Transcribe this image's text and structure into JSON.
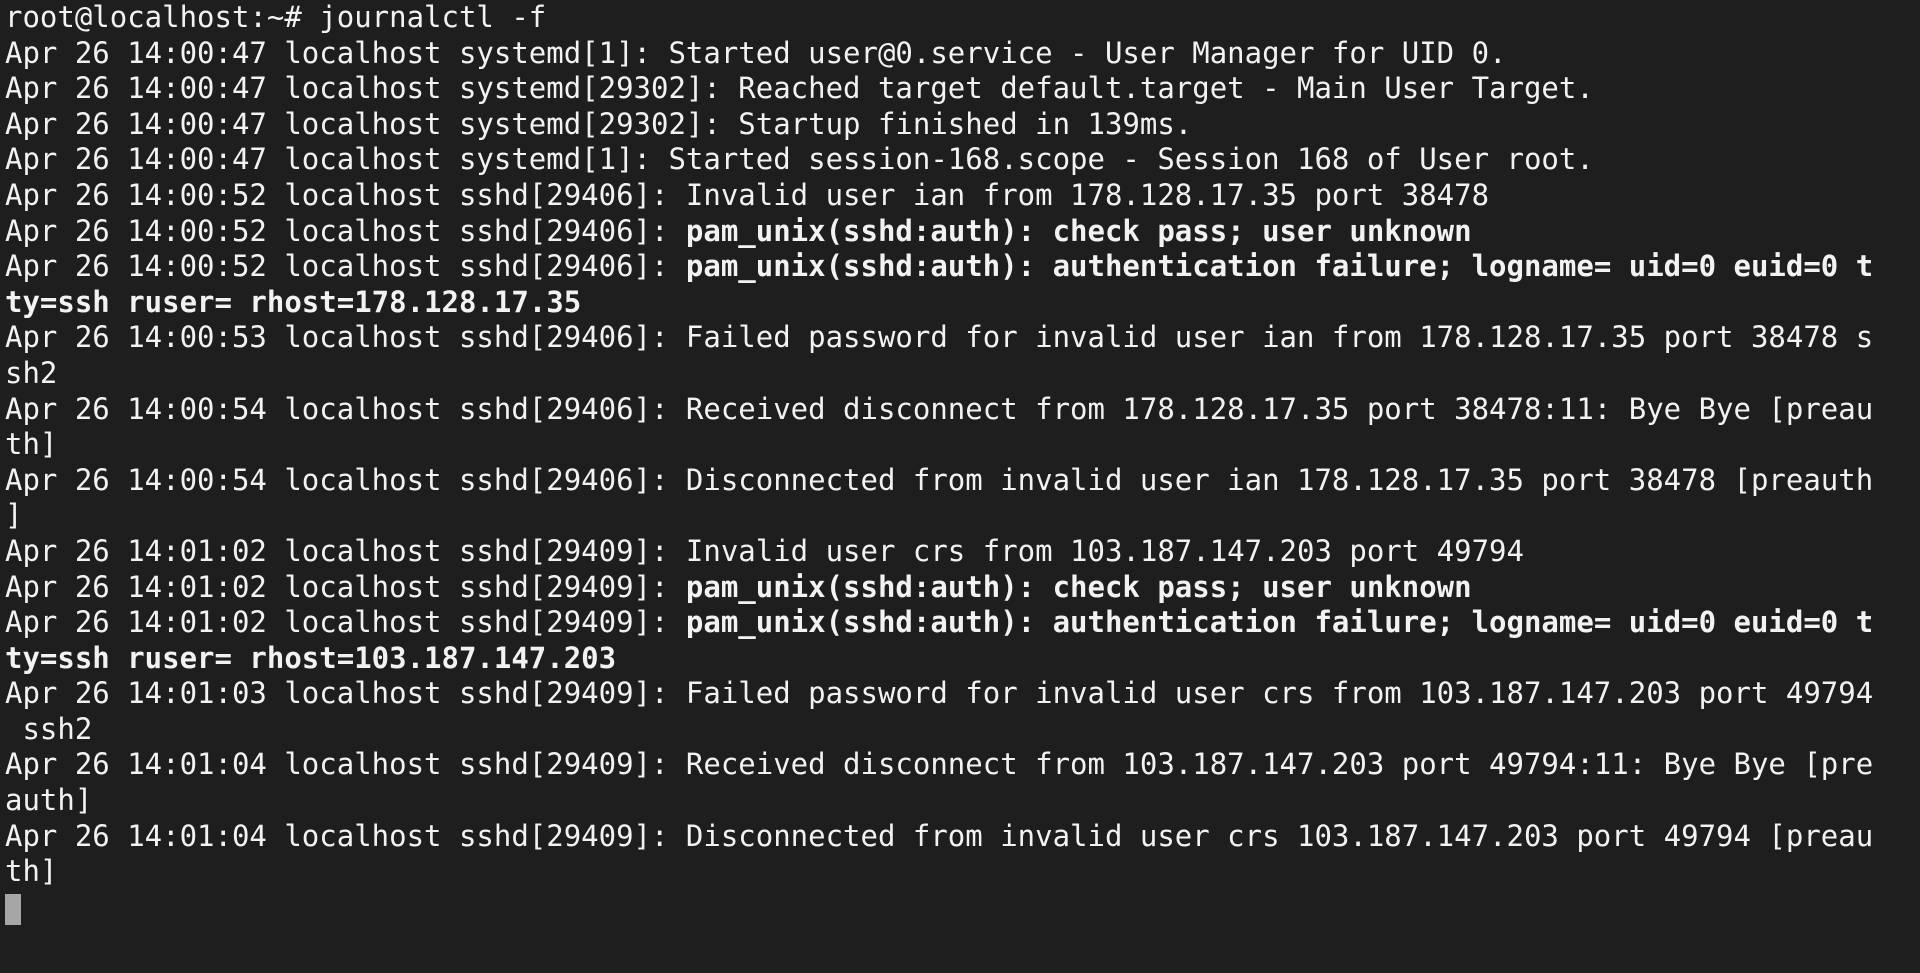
{
  "terminal": {
    "prompt": "root@localhost:~# journalctl -f",
    "rows": [
      [
        {
          "t": "Apr 26 14:00:47 localhost systemd[1]: Started user@0.service - User Manager for UID 0."
        }
      ],
      [
        {
          "t": "Apr 26 14:00:47 localhost systemd[29302]: Reached target default.target - Main User Target."
        }
      ],
      [
        {
          "t": "Apr 26 14:00:47 localhost systemd[29302]: Startup finished in 139ms."
        }
      ],
      [
        {
          "t": "Apr 26 14:00:47 localhost systemd[1]: Started session-168.scope - Session 168 of User root."
        }
      ],
      [
        {
          "t": "Apr 26 14:00:52 localhost sshd[29406]: Invalid user ian from 178.128.17.35 port 38478"
        }
      ],
      [
        {
          "t": "Apr 26 14:00:52 localhost sshd[29406]: "
        },
        {
          "t": "pam_unix(sshd:auth): check pass; user unknown",
          "b": true
        }
      ],
      [
        {
          "t": "Apr 26 14:00:52 localhost sshd[29406]: "
        },
        {
          "t": "pam_unix(sshd:auth): authentication failure; logname= uid=0 euid=0 t",
          "b": true
        }
      ],
      [
        {
          "t": "ty=ssh ruser= rhost=178.128.17.35",
          "b": true
        }
      ],
      [
        {
          "t": "Apr 26 14:00:53 localhost sshd[29406]: Failed password for invalid user ian from 178.128.17.35 port 38478 s"
        }
      ],
      [
        {
          "t": "sh2"
        }
      ],
      [
        {
          "t": "Apr 26 14:00:54 localhost sshd[29406]: Received disconnect from 178.128.17.35 port 38478:11: Bye Bye [preau"
        }
      ],
      [
        {
          "t": "th]"
        }
      ],
      [
        {
          "t": "Apr 26 14:00:54 localhost sshd[29406]: Disconnected from invalid user ian 178.128.17.35 port 38478 [preauth"
        }
      ],
      [
        {
          "t": "]"
        }
      ],
      [
        {
          "t": "Apr 26 14:01:02 localhost sshd[29409]: Invalid user crs from 103.187.147.203 port 49794"
        }
      ],
      [
        {
          "t": "Apr 26 14:01:02 localhost sshd[29409]: "
        },
        {
          "t": "pam_unix(sshd:auth): check pass; user unknown",
          "b": true
        }
      ],
      [
        {
          "t": "Apr 26 14:01:02 localhost sshd[29409]: "
        },
        {
          "t": "pam_unix(sshd:auth): authentication failure; logname= uid=0 euid=0 t",
          "b": true
        }
      ],
      [
        {
          "t": "ty=ssh ruser= rhost=103.187.147.203",
          "b": true
        }
      ],
      [
        {
          "t": "Apr 26 14:01:03 localhost sshd[29409]: Failed password for invalid user crs from 103.187.147.203 port 49794"
        }
      ],
      [
        {
          "t": " ssh2"
        }
      ],
      [
        {
          "t": "Apr 26 14:01:04 localhost sshd[29409]: Received disconnect from 103.187.147.203 port 49794:11: Bye Bye [pre"
        }
      ],
      [
        {
          "t": "auth]"
        }
      ],
      [
        {
          "t": "Apr 26 14:01:04 localhost sshd[29409]: Disconnected from invalid user crs 103.187.147.203 port 49794 [preau"
        }
      ],
      [
        {
          "t": "th]"
        }
      ]
    ]
  },
  "colors": {
    "background": "#1e1e1e",
    "text": "#f2f2f2",
    "cursor": "#a6a6a6"
  }
}
